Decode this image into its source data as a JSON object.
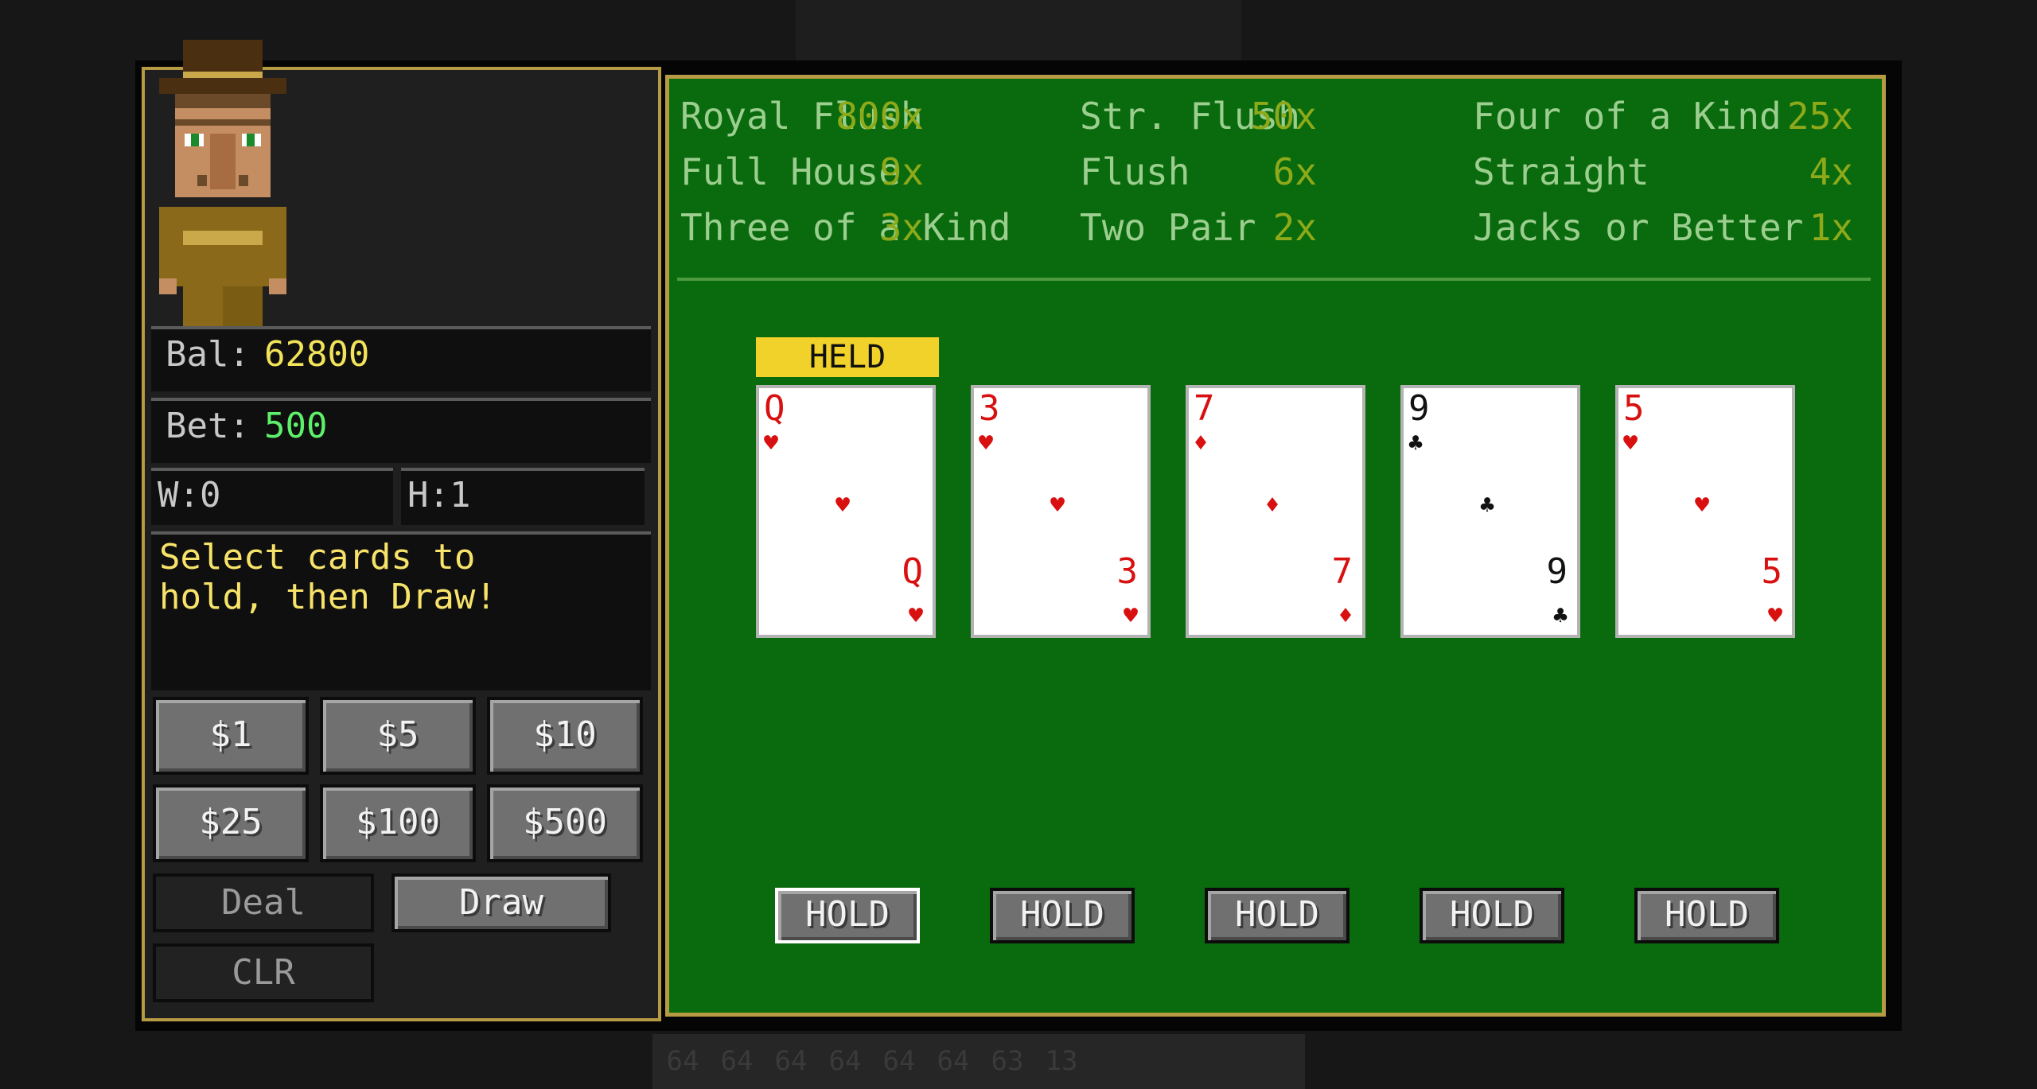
{
  "background": {
    "hotbar_counts": [
      "64",
      "64",
      "64",
      "64",
      "64",
      "64",
      "63",
      "13"
    ]
  },
  "player": {
    "balance_label": "Bal:",
    "balance_value": "62800",
    "bet_label": "Bet:",
    "bet_value": "500",
    "wins": "W:0",
    "hands": "H:1",
    "message_line1": "Select cards to",
    "message_line2": "hold, then Draw!"
  },
  "chips": [
    "$1",
    "$5",
    "$10",
    "$25",
    "$100",
    "$500"
  ],
  "actions": {
    "deal": "Deal",
    "draw": "Draw",
    "clear": "CLR"
  },
  "paytable": [
    [
      {
        "name": "Royal Flush",
        "mult": "800x"
      },
      {
        "name": "Str. Flush",
        "mult": "50x"
      },
      {
        "name": "Four of a Kind",
        "mult": "25x"
      }
    ],
    [
      {
        "name": "Full House",
        "mult": "9x"
      },
      {
        "name": "Flush",
        "mult": "6x"
      },
      {
        "name": "Straight",
        "mult": "4x"
      }
    ],
    [
      {
        "name": "Three of a Kind",
        "mult": "3x"
      },
      {
        "name": "Two Pair",
        "mult": "2x"
      },
      {
        "name": "Jacks or Better",
        "mult": "1x"
      }
    ]
  ],
  "held_label": "HELD",
  "hold_label": "HOLD",
  "cards": [
    {
      "rank": "Q",
      "suit": "♥",
      "color": "red",
      "held": true
    },
    {
      "rank": "3",
      "suit": "♥",
      "color": "red",
      "held": false
    },
    {
      "rank": "7",
      "suit": "♦",
      "color": "red",
      "held": false
    },
    {
      "rank": "9",
      "suit": "♣",
      "color": "black",
      "held": false
    },
    {
      "rank": "5",
      "suit": "♥",
      "color": "red",
      "held": false
    }
  ],
  "colors": {
    "felt": "#0a6a0e",
    "gold_border": "#b79a44",
    "held_tag": "#f0d22a",
    "balance": "#f2e35a",
    "bet": "#5df06a"
  }
}
